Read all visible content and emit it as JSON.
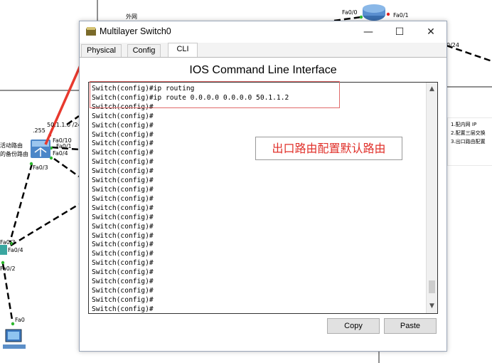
{
  "topology": {
    "cloud_label": "外网",
    "router_ports": [
      "Fa0/0",
      "Fa0/1"
    ],
    "link_label_right": "0/24",
    "subnet_label": "50.1.1.0 /24",
    "dot_label": ".255",
    "switch_ports": [
      "Fa0/10",
      "Fa0/1",
      "Fa0/4",
      "Fa0/3"
    ],
    "left_labels": [
      "活动路由",
      "的备份路由"
    ],
    "lower_switch_ports": [
      "Fa0/3",
      "Fa0/4",
      "Fa0/2"
    ],
    "pc_port": "Fa0"
  },
  "notes": {
    "lines": [
      "1.配内网 IP",
      "2.配置三层交换",
      "3.出口路由配置"
    ]
  },
  "window": {
    "title": "Multilayer Switch0",
    "controls": {
      "minimize": "—",
      "maximize": "☐",
      "close": "✕"
    },
    "tabs": [
      {
        "label": "Physical",
        "active": false
      },
      {
        "label": "Config",
        "active": false
      },
      {
        "label": "CLI",
        "active": true
      }
    ],
    "cli_title": "IOS Command Line Interface",
    "console_lines": [
      "Switch(config)#ip routing",
      "Switch(config)#ip route 0.0.0.0 0.0.0.0 50.1.1.2",
      "Switch(config)#",
      "Switch(config)#",
      "Switch(config)#",
      "Switch(config)#",
      "Switch(config)#",
      "Switch(config)#",
      "Switch(config)#",
      "Switch(config)#",
      "Switch(config)#",
      "Switch(config)#",
      "Switch(config)#",
      "Switch(config)#",
      "Switch(config)#",
      "Switch(config)#",
      "Switch(config)#",
      "Switch(config)#",
      "Switch(config)#",
      "Switch(config)#",
      "Switch(config)#",
      "Switch(config)#",
      "Switch(config)#",
      "Switch(config)#",
      "Switch(config)#",
      "Switch(config)#"
    ],
    "copy_label": "Copy",
    "paste_label": "Paste"
  },
  "annotation": {
    "text": "出口路由配置默认路由",
    "color": "#e0302a"
  }
}
